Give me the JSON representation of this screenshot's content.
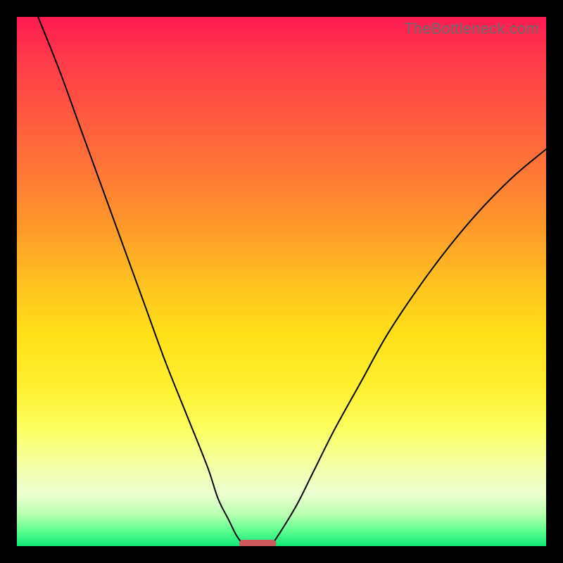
{
  "watermark": "TheBottleneck.com",
  "chart_data": {
    "type": "line",
    "title": "",
    "xlabel": "",
    "ylabel": "",
    "xlim": [
      0,
      100
    ],
    "ylim": [
      0,
      100
    ],
    "grid": false,
    "series": [
      {
        "name": "left-curve",
        "x": [
          4,
          8,
          12,
          16,
          20,
          24,
          28,
          32,
          36,
          38,
          40,
          41.5,
          43
        ],
        "y": [
          100,
          90,
          79,
          68,
          57,
          46,
          35,
          25,
          15,
          9,
          5,
          2,
          0
        ]
      },
      {
        "name": "right-curve",
        "x": [
          48,
          50,
          53,
          56,
          60,
          65,
          70,
          76,
          82,
          88,
          94,
          100
        ],
        "y": [
          0,
          3,
          8,
          14,
          22,
          31,
          40,
          49,
          57,
          64,
          70,
          75
        ]
      }
    ],
    "marker": {
      "x_start": 42,
      "x_end": 49,
      "y": 0,
      "color": "#cf5a5e"
    }
  }
}
